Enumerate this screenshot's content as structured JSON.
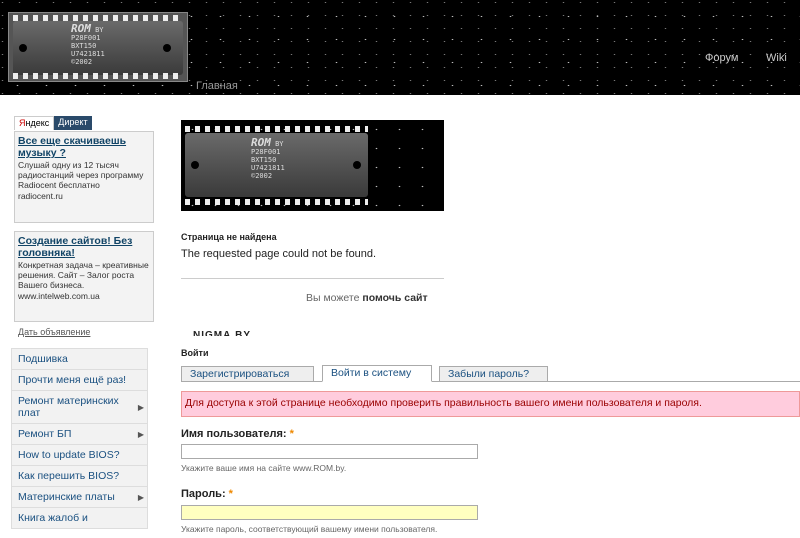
{
  "header": {
    "logo_chip": {
      "brand": "ROM",
      "brand_sub": "BY",
      "lines": [
        "P28F001",
        "BXT150",
        "U7421811",
        "©2002"
      ]
    },
    "home_label": "Главная",
    "nav": [
      {
        "label": "Форум"
      },
      {
        "label": "Wiki"
      }
    ]
  },
  "sidebar": {
    "ad_tabs": {
      "yandex_first": "Я",
      "yandex_rest": "ндекс",
      "direct": "Директ"
    },
    "ads": [
      {
        "title": "Все еще скачиваешь музыку ?",
        "text": "Слушай одну из 12 тысяч радиостанций через программу Radiocent бесплатно",
        "url": "radiocent.ru"
      },
      {
        "title": "Создание сайтов! Без головняка!",
        "text": "Конкретная задача – креативные решения. Сайт – Залог роста Вашего бизнеса.",
        "url": "www.intelweb.com.ua"
      }
    ],
    "give_ad": "Дать объявление",
    "menu": [
      {
        "label": "Подшивка",
        "arrow": ""
      },
      {
        "label": "Прочти меня ещё раз!",
        "arrow": ""
      },
      {
        "label": "Ремонт материнских плат",
        "arrow": "▶"
      },
      {
        "label": "Ремонт БП",
        "arrow": "▶"
      },
      {
        "label": "How to update BIOS?",
        "arrow": ""
      },
      {
        "label": "Как перешить BIOS?",
        "arrow": ""
      },
      {
        "label": "Материнские платы",
        "arrow": "▶"
      },
      {
        "label": "Книга жалоб и",
        "arrow": ""
      }
    ]
  },
  "main": {
    "not_found_title": "Страница не найдена",
    "not_found_text": "The requested page could not be found.",
    "help_prefix": "Вы можете ",
    "help_bold": "помочь сайт",
    "nigma": "NIGMA.BY",
    "login_title": "Войти",
    "tabs": [
      {
        "label": "Зарегистрироваться",
        "active": false
      },
      {
        "label": "Войти в систему",
        "active": true
      },
      {
        "label": "Забыли пароль?",
        "active": false
      }
    ],
    "error": "Для доступа к этой странице необходимо проверить правильность вашего имени пользователя и пароля.",
    "username": {
      "label": "Имя пользователя:",
      "required": "*",
      "value": "",
      "hint": "Укажите ваше имя на сайте www.ROM.by."
    },
    "password": {
      "label": "Пароль:",
      "required": "*",
      "value": "",
      "hint": "Укажите пароль, соответствующий вашему имени пользователя."
    }
  }
}
